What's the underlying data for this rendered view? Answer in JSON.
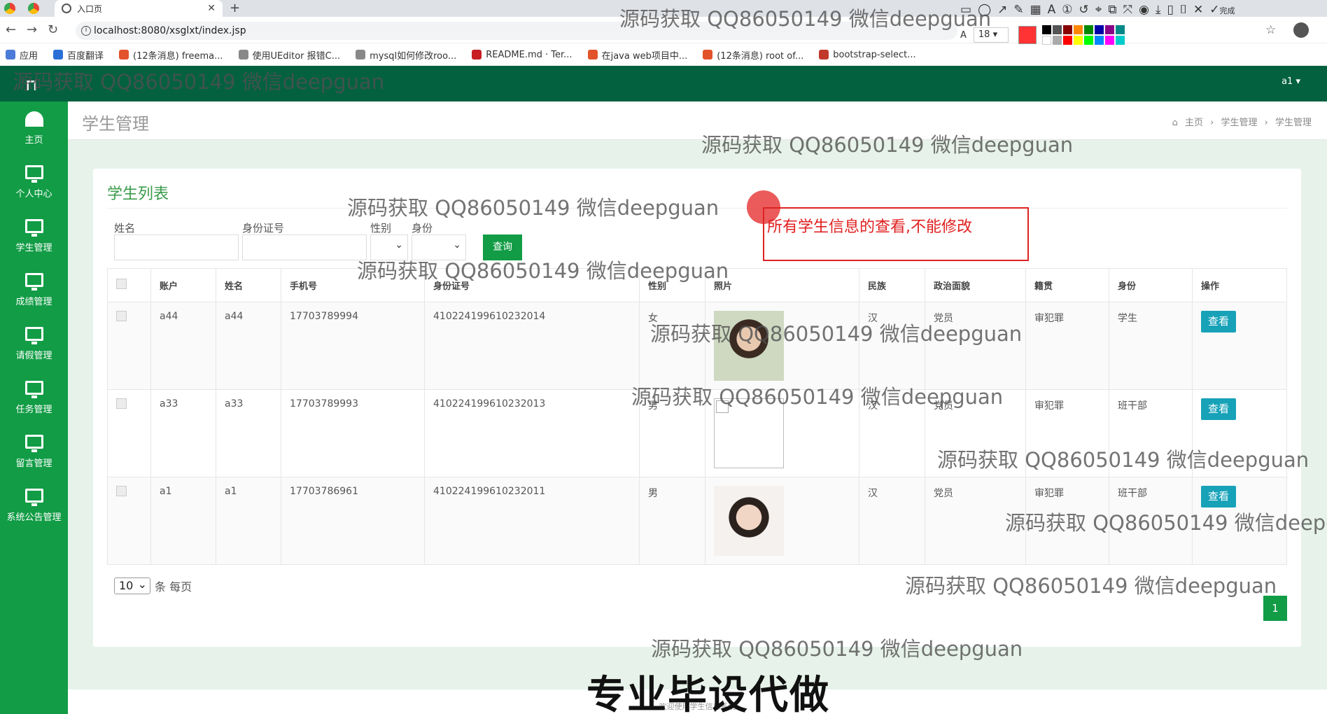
{
  "browser": {
    "tab_title": "入口页",
    "url": "localhost:8080/xsglxt/index.jsp",
    "bookmarks": [
      "应用",
      "百度翻译",
      "(12条消息) freema...",
      "使用UEditor 报错C...",
      "mysql如何修改roo...",
      "README.md · Ter...",
      "在java web项目中...",
      "(12条消息) root of...",
      "bootstrap-select..."
    ]
  },
  "annotation_toolbar": {
    "font_size": "18",
    "current_color": "#ff3333",
    "done_label": "完成"
  },
  "app": {
    "user": "a1 ▾",
    "sidebar": [
      {
        "label": "主页",
        "icon": "dashboard-icon"
      },
      {
        "label": "个人中心",
        "icon": "monitor-icon"
      },
      {
        "label": "学生管理",
        "icon": "monitor-icon"
      },
      {
        "label": "成绩管理",
        "icon": "monitor-icon"
      },
      {
        "label": "请假管理",
        "icon": "monitor-icon"
      },
      {
        "label": "任务管理",
        "icon": "monitor-icon"
      },
      {
        "label": "留言管理",
        "icon": "monitor-icon"
      },
      {
        "label": "系统公告管理",
        "icon": "monitor-icon"
      }
    ],
    "page_title": "学生管理",
    "breadcrumb": [
      "主页",
      "学生管理",
      "学生管理"
    ],
    "panel_title": "学生列表",
    "filters": {
      "name_label": "姓名",
      "id_label": "身份证号",
      "gender_label": "性别",
      "role_label": "身份",
      "search_button": "查询"
    },
    "table": {
      "headers": [
        "账户",
        "姓名",
        "手机号",
        "身份证号",
        "性别",
        "照片",
        "民族",
        "政治面貌",
        "籍贯",
        "身份",
        "操作"
      ],
      "rows": [
        {
          "account": "a44",
          "name": "a44",
          "phone": "17703789994",
          "idcard": "410224199610232014",
          "gender": "女",
          "nation": "汉",
          "politics": "党员",
          "origin": "审犯罪",
          "role": "学生",
          "photo": "portrait"
        },
        {
          "account": "a33",
          "name": "a33",
          "phone": "17703789993",
          "idcard": "410224199610232013",
          "gender": "男",
          "nation": "汉",
          "politics": "党员",
          "origin": "审犯罪",
          "role": "班干部",
          "photo": "broken"
        },
        {
          "account": "a1",
          "name": "a1",
          "phone": "17703786961",
          "idcard": "410224199610232011",
          "gender": "男",
          "nation": "汉",
          "politics": "党员",
          "origin": "审犯罪",
          "role": "班干部",
          "photo": "portrait"
        }
      ],
      "view_button": "查看"
    },
    "pager": {
      "page_size": "10",
      "suffix": "条 每页",
      "current_page": "1"
    },
    "footer": "欢迎使用学生信息系统"
  },
  "overlay": {
    "note": "所有学生信息的查看,不能修改",
    "watermark": "源码获取 QQ86050149 微信deepguan",
    "big_caption": "专业毕设代做"
  }
}
